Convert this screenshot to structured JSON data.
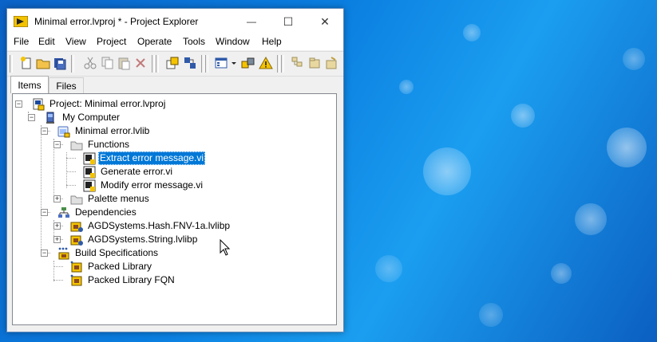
{
  "window": {
    "title": "Minimal error.lvproj * - Project Explorer",
    "minimize_glyph": "—",
    "maximize_glyph": "☐",
    "close_glyph": "✕"
  },
  "menu": [
    "File",
    "Edit",
    "View",
    "Project",
    "Operate",
    "Tools",
    "Window",
    "Help"
  ],
  "toolbar_icons": [
    "new-file-icon",
    "open-folder-icon",
    "save-all-icon",
    "cut-icon",
    "copy-icon",
    "paste-icon",
    "delete-icon",
    "build-icon",
    "deploy-icon",
    "view-options-icon",
    "dropdown-arrow-icon",
    "resolve-conflicts-icon",
    "warning-icon",
    "expand-all-icon",
    "collapse-all-icon",
    "add-file-icon"
  ],
  "tabs": [
    {
      "label": "Items",
      "active": true
    },
    {
      "label": "Files",
      "active": false
    }
  ],
  "tree": [
    {
      "id": "project",
      "label": "Project: Minimal error.lvproj",
      "icon": "project-icon",
      "expander": "−"
    },
    {
      "id": "my-computer",
      "label": "My Computer",
      "icon": "computer-icon",
      "expander": "−"
    },
    {
      "id": "library",
      "label": "Minimal error.lvlib",
      "icon": "library-icon",
      "expander": "−"
    },
    {
      "id": "functions",
      "label": "Functions",
      "icon": "folder-icon",
      "expander": "−"
    },
    {
      "id": "extract-vi",
      "label": "Extract error message.vi",
      "icon": "vi-icon",
      "expander": "",
      "selected": true
    },
    {
      "id": "generate-vi",
      "label": "Generate error.vi",
      "icon": "vi-icon",
      "expander": ""
    },
    {
      "id": "modify-vi",
      "label": "Modify error message.vi",
      "icon": "vi-icon",
      "expander": ""
    },
    {
      "id": "palette",
      "label": "Palette menus",
      "icon": "folder-icon",
      "expander": "+"
    },
    {
      "id": "dependencies",
      "label": "Dependencies",
      "icon": "dependencies-icon",
      "expander": "−"
    },
    {
      "id": "hash-lib",
      "label": "AGDSystems.Hash.FNV-1a.lvlibp",
      "icon": "packed-library-icon",
      "expander": "+"
    },
    {
      "id": "string-lib",
      "label": "AGDSystems.String.lvlibp",
      "icon": "packed-library-icon",
      "expander": "+"
    },
    {
      "id": "build-specs",
      "label": "Build Specifications",
      "icon": "build-spec-icon",
      "expander": "−"
    },
    {
      "id": "packed-lib",
      "label": "Packed Library",
      "icon": "packed-library-build-icon",
      "expander": ""
    },
    {
      "id": "packed-lib-fqn",
      "label": "Packed Library FQN",
      "icon": "packed-library-build-icon",
      "expander": ""
    }
  ],
  "colors": {
    "selection": "#0078d7",
    "desktop": "#0a7ee0",
    "window_border": "#5e88b8"
  }
}
